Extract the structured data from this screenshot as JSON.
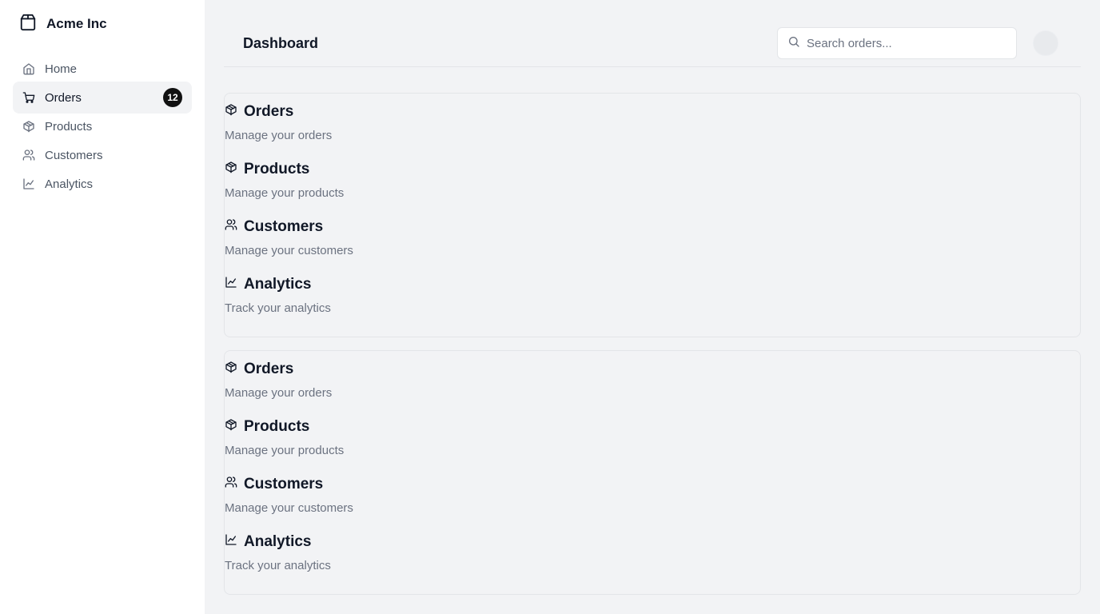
{
  "sidebar": {
    "brand": {
      "name": "Acme Inc",
      "icon": "package-icon"
    },
    "items": [
      {
        "label": "Home",
        "icon": "home-icon",
        "active": false
      },
      {
        "label": "Orders",
        "icon": "cart-icon",
        "active": true,
        "badge": "12"
      },
      {
        "label": "Products",
        "icon": "package-icon",
        "active": false
      },
      {
        "label": "Customers",
        "icon": "users-icon",
        "active": false
      },
      {
        "label": "Analytics",
        "icon": "line-chart-icon",
        "active": false
      }
    ]
  },
  "header": {
    "title": "Dashboard",
    "search": {
      "placeholder": "Search orders...",
      "value": ""
    }
  },
  "cards": [
    {
      "items": [
        {
          "title": "Orders",
          "desc": "Manage your orders",
          "icon": "package-icon"
        },
        {
          "title": "Products",
          "desc": "Manage your products",
          "icon": "package-icon"
        },
        {
          "title": "Customers",
          "desc": "Manage your customers",
          "icon": "users-icon"
        },
        {
          "title": "Analytics",
          "desc": "Track your analytics",
          "icon": "line-chart-icon"
        }
      ]
    },
    {
      "items": [
        {
          "title": "Orders",
          "desc": "Manage your orders",
          "icon": "package-icon"
        },
        {
          "title": "Products",
          "desc": "Manage your products",
          "icon": "package-icon"
        },
        {
          "title": "Customers",
          "desc": "Manage your customers",
          "icon": "users-icon"
        },
        {
          "title": "Analytics",
          "desc": "Track your analytics",
          "icon": "line-chart-icon"
        }
      ]
    }
  ],
  "colors": {
    "background": "#f2f3f5",
    "sidebar": "#ffffff",
    "badge": "#111111",
    "muted_text": "#6b7280",
    "border": "#e3e5e8"
  }
}
